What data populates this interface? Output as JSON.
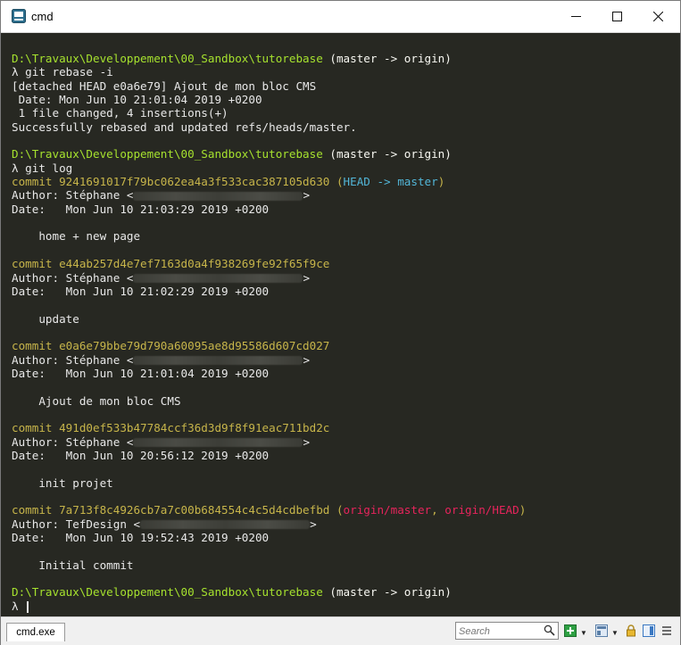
{
  "window": {
    "title": "cmd"
  },
  "terminal": {
    "lines": [
      [
        {
          "t": "D:\\Travaux\\Developpement\\00_Sandbox\\tutorebase",
          "c": "path"
        },
        {
          "t": " (master -> origin)",
          "c": "branch"
        }
      ],
      [
        {
          "t": "λ git rebase -i",
          "c": ""
        }
      ],
      [
        {
          "t": "[detached HEAD e0a6e79] Ajout de mon bloc CMS",
          "c": ""
        }
      ],
      [
        {
          "t": " Date: Mon Jun 10 21:01:04 2019 +0200",
          "c": ""
        }
      ],
      [
        {
          "t": " 1 file changed, 4 insertions(+)",
          "c": ""
        }
      ],
      [
        {
          "t": "Successfully rebased and updated refs/heads/master.",
          "c": ""
        }
      ],
      [
        {
          "t": "",
          "c": ""
        }
      ],
      [
        {
          "t": "D:\\Travaux\\Developpement\\00_Sandbox\\tutorebase",
          "c": "path"
        },
        {
          "t": " (master -> origin)",
          "c": "branch"
        }
      ],
      [
        {
          "t": "λ git log",
          "c": ""
        }
      ],
      [
        {
          "t": "commit 9241691017f79bc062ea4a3f533cac387105d630 ",
          "c": "commit"
        },
        {
          "t": "(",
          "c": "decor-yellow"
        },
        {
          "t": "HEAD -> master",
          "c": "decor-cyan"
        },
        {
          "t": ")",
          "c": "decor-yellow"
        }
      ],
      [
        {
          "t": "Author: Stéphane <",
          "c": ""
        },
        {
          "blur": 190
        },
        {
          "t": ">",
          "c": ""
        }
      ],
      [
        {
          "t": "Date:   Mon Jun 10 21:03:29 2019 +0200",
          "c": ""
        }
      ],
      [
        {
          "t": "",
          "c": ""
        }
      ],
      [
        {
          "t": "    home + new page",
          "c": ""
        }
      ],
      [
        {
          "t": "",
          "c": ""
        }
      ],
      [
        {
          "t": "commit e44ab257d4e7ef7163d0a4f938269fe92f65f9ce",
          "c": "commit"
        }
      ],
      [
        {
          "t": "Author: Stéphane <",
          "c": ""
        },
        {
          "blur": 190
        },
        {
          "t": ">",
          "c": ""
        }
      ],
      [
        {
          "t": "Date:   Mon Jun 10 21:02:29 2019 +0200",
          "c": ""
        }
      ],
      [
        {
          "t": "",
          "c": ""
        }
      ],
      [
        {
          "t": "    update",
          "c": ""
        }
      ],
      [
        {
          "t": "",
          "c": ""
        }
      ],
      [
        {
          "t": "commit e0a6e79bbe79d790a60095ae8d95586d607cd027",
          "c": "commit"
        }
      ],
      [
        {
          "t": "Author: Stéphane <",
          "c": ""
        },
        {
          "blur": 190
        },
        {
          "t": ">",
          "c": ""
        }
      ],
      [
        {
          "t": "Date:   Mon Jun 10 21:01:04 2019 +0200",
          "c": ""
        }
      ],
      [
        {
          "t": "",
          "c": ""
        }
      ],
      [
        {
          "t": "    Ajout de mon bloc CMS",
          "c": ""
        }
      ],
      [
        {
          "t": "",
          "c": ""
        }
      ],
      [
        {
          "t": "commit 491d0ef533b47784ccf36d3d9f8f91eac711bd2c",
          "c": "commit"
        }
      ],
      [
        {
          "t": "Author: Stéphane <",
          "c": ""
        },
        {
          "blur": 190
        },
        {
          "t": ">",
          "c": ""
        }
      ],
      [
        {
          "t": "Date:   Mon Jun 10 20:56:12 2019 +0200",
          "c": ""
        }
      ],
      [
        {
          "t": "",
          "c": ""
        }
      ],
      [
        {
          "t": "    init projet",
          "c": ""
        }
      ],
      [
        {
          "t": "",
          "c": ""
        }
      ],
      [
        {
          "t": "commit 7a713f8c4926cb7a7c00b684554c4c5d4cdbefbd ",
          "c": "commit"
        },
        {
          "t": "(",
          "c": "decor-yellow"
        },
        {
          "t": "origin/master",
          "c": "decor-red"
        },
        {
          "t": ", ",
          "c": "decor-yellow"
        },
        {
          "t": "origin/HEAD",
          "c": "decor-red"
        },
        {
          "t": ")",
          "c": "decor-yellow"
        }
      ],
      [
        {
          "t": "Author: TefDesign <",
          "c": ""
        },
        {
          "blur": 190
        },
        {
          "t": ">",
          "c": ""
        }
      ],
      [
        {
          "t": "Date:   Mon Jun 10 19:52:43 2019 +0200",
          "c": ""
        }
      ],
      [
        {
          "t": "",
          "c": ""
        }
      ],
      [
        {
          "t": "    Initial commit",
          "c": ""
        }
      ],
      [
        {
          "t": "",
          "c": ""
        }
      ],
      [
        {
          "t": "D:\\Travaux\\Developpement\\00_Sandbox\\tutorebase",
          "c": "path"
        },
        {
          "t": " (master -> origin)",
          "c": "branch"
        }
      ],
      [
        {
          "t": "λ ",
          "c": ""
        },
        {
          "cursor": true
        }
      ]
    ]
  },
  "statusbar": {
    "tab_label": "cmd.exe",
    "search_placeholder": "Search"
  },
  "colors": {
    "background": "#272822",
    "prompt_path": "#a6e22e",
    "commit_hash": "#c7b54a",
    "head_ref": "#52b6d8",
    "origin_ref": "#e7245c"
  }
}
